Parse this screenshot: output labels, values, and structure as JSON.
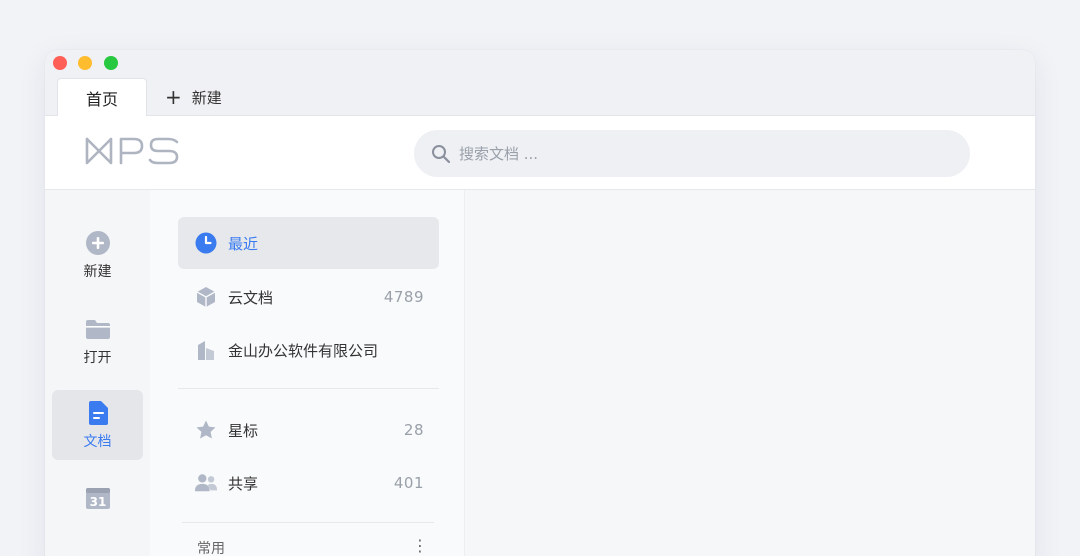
{
  "tabs": {
    "home": "首页",
    "new": "新建"
  },
  "logo": {
    "text": "WPS"
  },
  "search": {
    "placeholder": "搜索文档 ..."
  },
  "rail": {
    "items": [
      {
        "label": "新建"
      },
      {
        "label": "打开"
      },
      {
        "label": "文档"
      },
      {
        "label": "31"
      }
    ]
  },
  "nav": {
    "recent": {
      "label": "最近"
    },
    "cloud": {
      "label": "云文档",
      "count": "4789"
    },
    "company": {
      "label": "金山办公软件有限公司"
    },
    "starred": {
      "label": "星标",
      "count": "28"
    },
    "shared": {
      "label": "共享",
      "count": "401"
    }
  },
  "section": {
    "common": "常用",
    "more": "⋮"
  },
  "colors": {
    "accent": "#3a7bf0",
    "icon_gray": "#b0b7c6"
  }
}
